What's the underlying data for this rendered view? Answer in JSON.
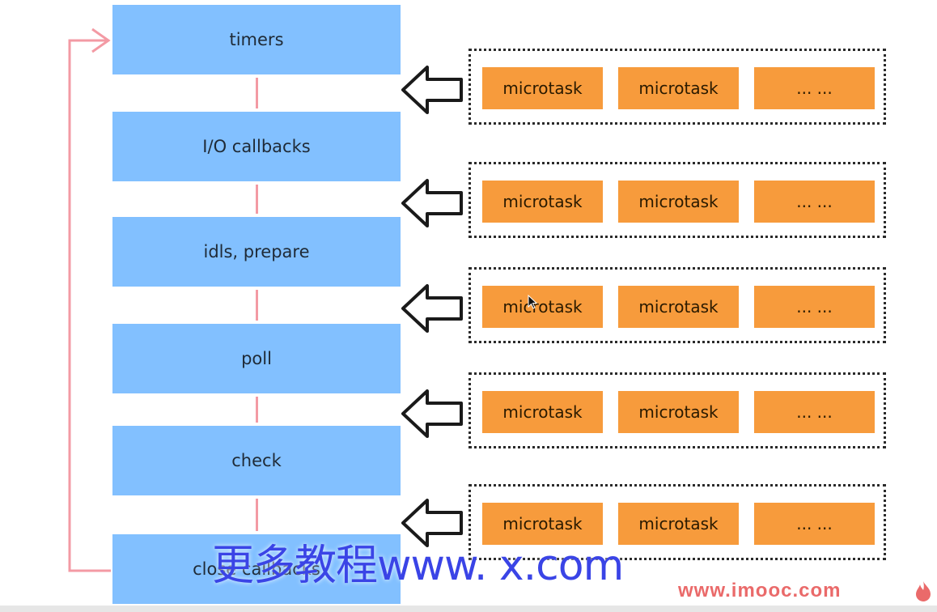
{
  "phases": [
    {
      "label": "timers"
    },
    {
      "label": "I/O callbacks"
    },
    {
      "label": "idls, prepare"
    },
    {
      "label": "poll"
    },
    {
      "label": "check"
    },
    {
      "label": "close callbacks"
    }
  ],
  "queues": [
    {
      "tasks": [
        "microtask",
        "microtask",
        "... ..."
      ]
    },
    {
      "tasks": [
        "microtask",
        "microtask",
        "... ..."
      ]
    },
    {
      "tasks": [
        "microtask",
        "microtask",
        "... ..."
      ]
    },
    {
      "tasks": [
        "microtask",
        "microtask",
        "... ..."
      ]
    },
    {
      "tasks": [
        "microtask",
        "microtask",
        "... ..."
      ]
    }
  ],
  "watermark": {
    "promo": "更多教程www.    x.com",
    "site": "www.imooc.com"
  },
  "colors": {
    "phase": "#82c0ff",
    "task": "#f79b3c",
    "loop": "#f39aa4",
    "watermark": "#3a44e6",
    "site": "#ea6a6a"
  }
}
